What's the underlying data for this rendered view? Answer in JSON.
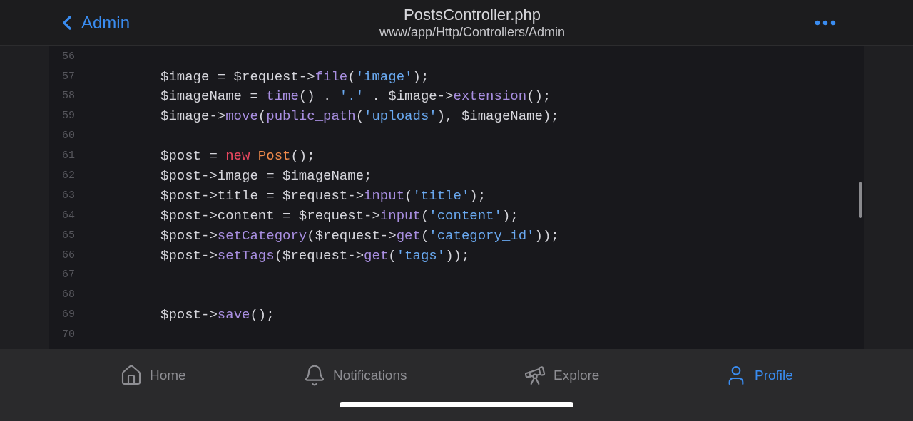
{
  "nav": {
    "back": "Admin",
    "title": "PostsController.php",
    "subtitle": "www/app/Http/Controllers/Admin"
  },
  "code": [
    {
      "number": "56"
    },
    {
      "number": "57",
      "tokens": [
        {
          "kind": "plain",
          "text": "$image = $request->"
        },
        {
          "kind": "func",
          "text": "file"
        },
        {
          "kind": "plain",
          "text": "("
        },
        {
          "kind": "string",
          "text": "'image'"
        },
        {
          "kind": "plain",
          "text": ");"
        }
      ]
    },
    {
      "number": "58",
      "tokens": [
        {
          "kind": "plain",
          "text": "$imageName = "
        },
        {
          "kind": "func",
          "text": "time"
        },
        {
          "kind": "plain",
          "text": "() . "
        },
        {
          "kind": "string",
          "text": "'.'"
        },
        {
          "kind": "plain",
          "text": " . $image->"
        },
        {
          "kind": "func",
          "text": "extension"
        },
        {
          "kind": "plain",
          "text": "();"
        }
      ]
    },
    {
      "number": "59",
      "tokens": [
        {
          "kind": "plain",
          "text": "$image->"
        },
        {
          "kind": "func",
          "text": "move"
        },
        {
          "kind": "plain",
          "text": "("
        },
        {
          "kind": "func",
          "text": "public_path"
        },
        {
          "kind": "plain",
          "text": "("
        },
        {
          "kind": "string",
          "text": "'uploads'"
        },
        {
          "kind": "plain",
          "text": "), $imageName);"
        }
      ]
    },
    {
      "number": "60"
    },
    {
      "number": "61",
      "tokens": [
        {
          "kind": "plain",
          "text": "$post = "
        },
        {
          "kind": "keyword",
          "text": "new"
        },
        {
          "kind": "class",
          "text": " Post"
        },
        {
          "kind": "plain",
          "text": "();"
        }
      ]
    },
    {
      "number": "62",
      "tokens": [
        {
          "kind": "plain",
          "text": "$post->image = $imageName;"
        }
      ]
    },
    {
      "number": "63",
      "tokens": [
        {
          "kind": "plain",
          "text": "$post->title = $request->"
        },
        {
          "kind": "func",
          "text": "input"
        },
        {
          "kind": "plain",
          "text": "("
        },
        {
          "kind": "string",
          "text": "'title'"
        },
        {
          "kind": "plain",
          "text": ");"
        }
      ]
    },
    {
      "number": "64",
      "tokens": [
        {
          "kind": "plain",
          "text": "$post->content = $request->"
        },
        {
          "kind": "func",
          "text": "input"
        },
        {
          "kind": "plain",
          "text": "("
        },
        {
          "kind": "string",
          "text": "'content'"
        },
        {
          "kind": "plain",
          "text": ");"
        }
      ]
    },
    {
      "number": "65",
      "tokens": [
        {
          "kind": "plain",
          "text": "$post->"
        },
        {
          "kind": "func",
          "text": "setCategory"
        },
        {
          "kind": "plain",
          "text": "($request->"
        },
        {
          "kind": "func",
          "text": "get"
        },
        {
          "kind": "plain",
          "text": "("
        },
        {
          "kind": "string",
          "text": "'category_id'"
        },
        {
          "kind": "plain",
          "text": "));"
        }
      ]
    },
    {
      "number": "66",
      "tokens": [
        {
          "kind": "plain",
          "text": "$post->"
        },
        {
          "kind": "func",
          "text": "setTags"
        },
        {
          "kind": "plain",
          "text": "($request->"
        },
        {
          "kind": "func",
          "text": "get"
        },
        {
          "kind": "plain",
          "text": "("
        },
        {
          "kind": "string",
          "text": "'tags'"
        },
        {
          "kind": "plain",
          "text": "));"
        }
      ]
    },
    {
      "number": "67"
    },
    {
      "number": "68"
    },
    {
      "number": "69",
      "tokens": [
        {
          "kind": "plain",
          "text": "$post->"
        },
        {
          "kind": "func",
          "text": "save"
        },
        {
          "kind": "plain",
          "text": "();"
        }
      ]
    },
    {
      "number": "70"
    }
  ],
  "tabs": [
    {
      "kind": "home",
      "label": "Home",
      "selected": false
    },
    {
      "kind": "bell",
      "label": "Notifications",
      "selected": false
    },
    {
      "kind": "telescope",
      "label": "Explore",
      "selected": false
    },
    {
      "kind": "user",
      "label": "Profile",
      "selected": true
    }
  ]
}
